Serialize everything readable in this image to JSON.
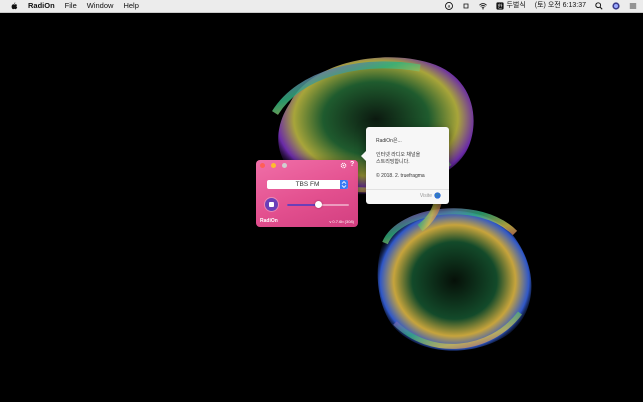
{
  "menubar": {
    "app_name": "RadiOn",
    "items": [
      "File",
      "Window",
      "Help"
    ],
    "input_source": "두벌식",
    "clock": "(토) 오전 6:13:37"
  },
  "radio": {
    "station": "TBS FM",
    "volume_fraction": 0.5,
    "app_label": "RadiOn",
    "version": "v 0.7.6b (308)",
    "help_label": "?"
  },
  "about": {
    "line1": "RadiOn은...",
    "line2": "인터넷 라디오 채널을",
    "line3": "스트리밍합니다.",
    "copyright": "© 2018. 2. truefragma",
    "visit": "Visite"
  },
  "colors": {
    "window_gradient": [
      "#f06fa8",
      "#d23f80"
    ],
    "accent": "#6a3fb8",
    "select_arrow": "#3b7bf5"
  }
}
